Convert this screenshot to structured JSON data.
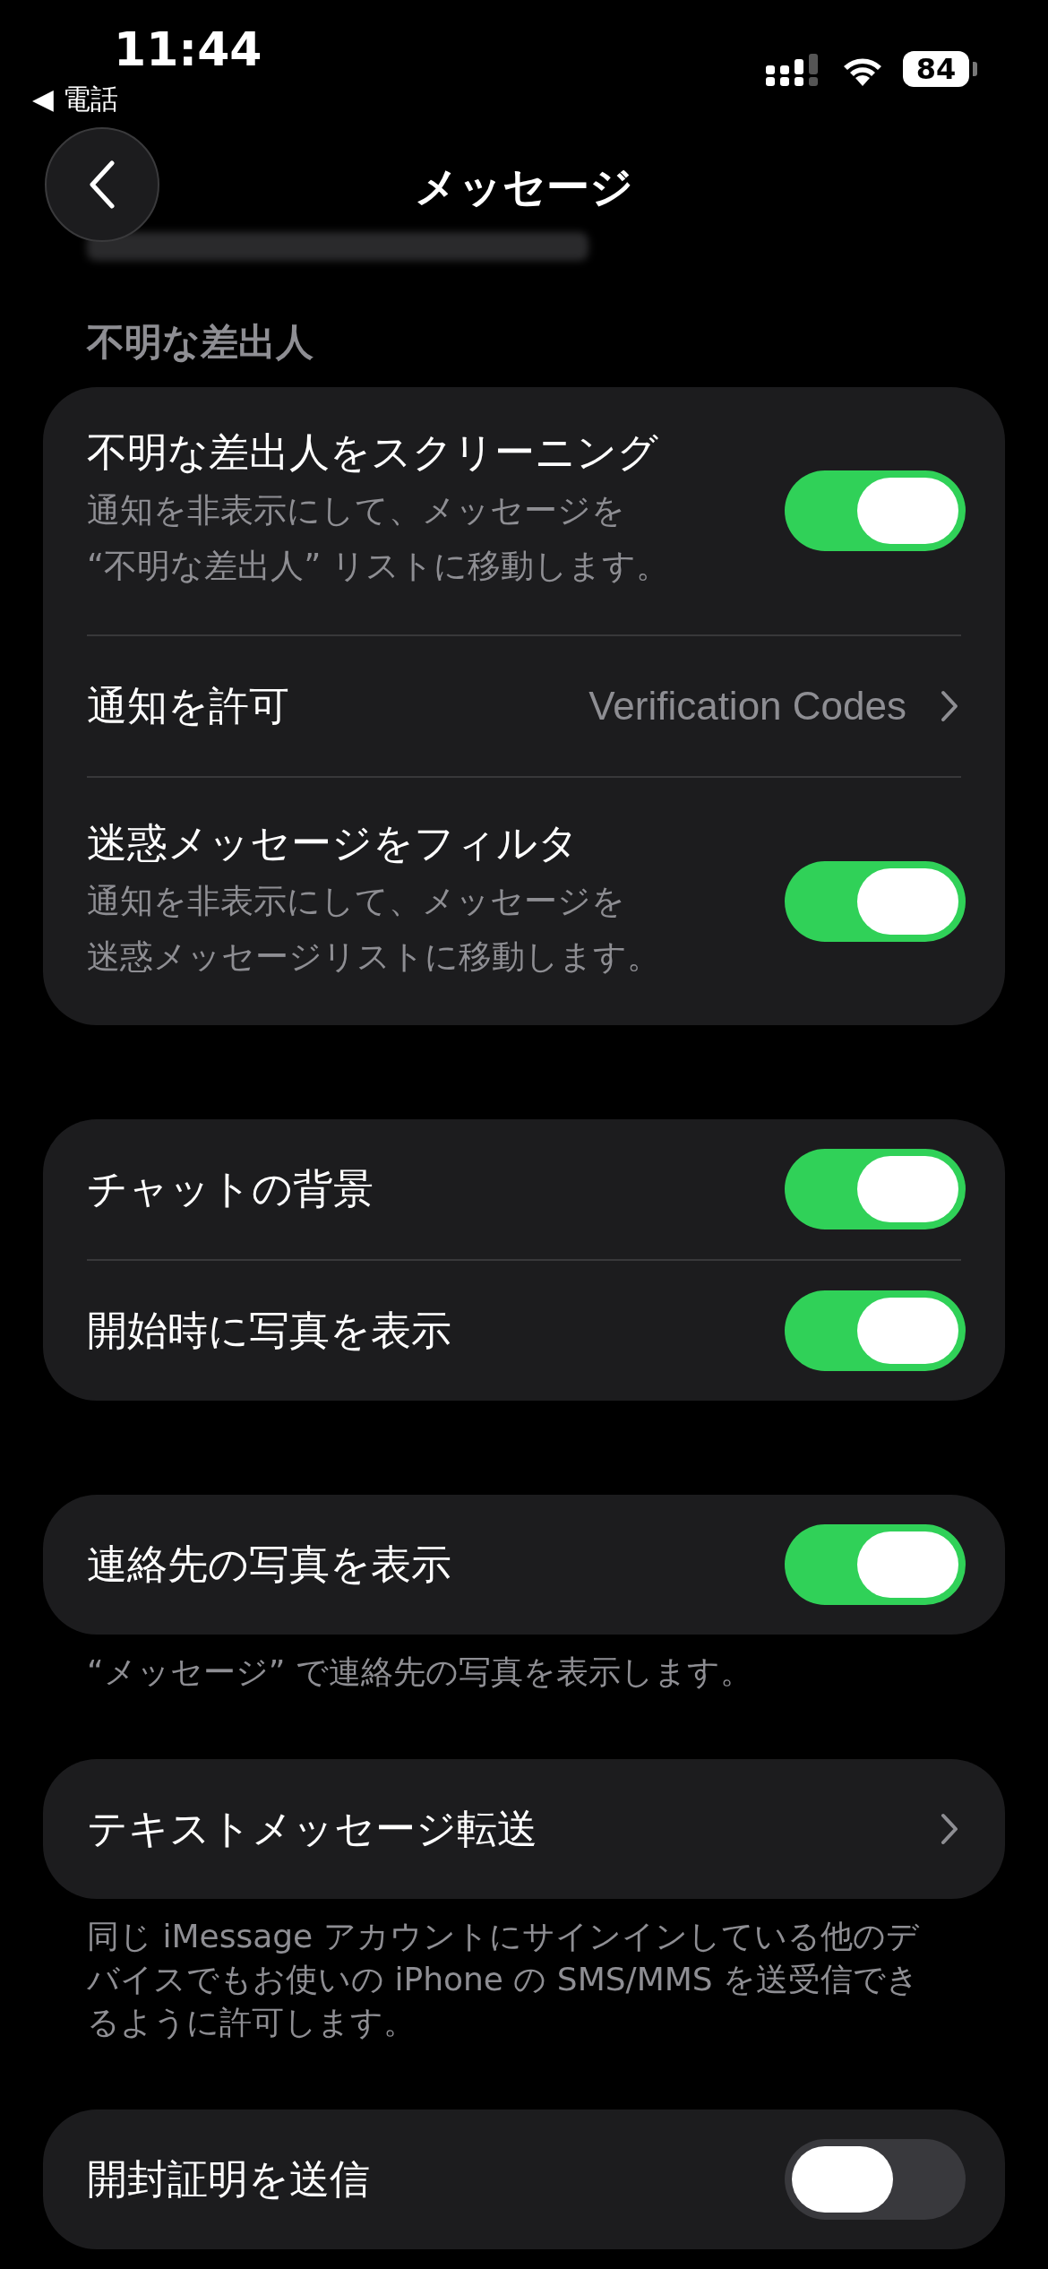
{
  "status_bar": {
    "time": "11:44",
    "back_app": "◀ 電話",
    "battery": "84"
  },
  "nav": {
    "title": "メッセージ"
  },
  "sections": [
    {
      "header": "不明な差出人",
      "rows": [
        {
          "kind": "toggle",
          "title": "不明な差出人をスクリーニング",
          "subtitle": [
            "通知を非表示にして、メッセージを",
            "“不明な差出人” リストに移動します。"
          ],
          "on": true
        },
        {
          "kind": "link",
          "title": "通知を許可",
          "value": "Verification Codes"
        },
        {
          "kind": "toggle",
          "title": "迷惑メッセージをフィルタ",
          "subtitle": [
            "通知を非表示にして、メッセージを",
            "迷惑メッセージリストに移動します。"
          ],
          "on": true
        }
      ]
    },
    {
      "rows": [
        {
          "kind": "toggle",
          "title": "チャットの背景",
          "on": true
        },
        {
          "kind": "toggle",
          "title": "開始時に写真を表示",
          "on": true
        }
      ]
    },
    {
      "rows": [
        {
          "kind": "toggle",
          "title": "連絡先の写真を表示",
          "on": true
        }
      ],
      "footer": "“メッセージ” で連絡先の写真を表示します。"
    },
    {
      "rows": [
        {
          "kind": "link",
          "title": "テキストメッセージ転送"
        }
      ],
      "footer": "同じ iMessage アカウントにサインインしている他のデバイスでもお使いの iPhone の SMS/MMS を送受信できるように許可します。"
    },
    {
      "rows": [
        {
          "kind": "toggle",
          "title": "開封証明を送信",
          "on": false
        }
      ]
    }
  ]
}
